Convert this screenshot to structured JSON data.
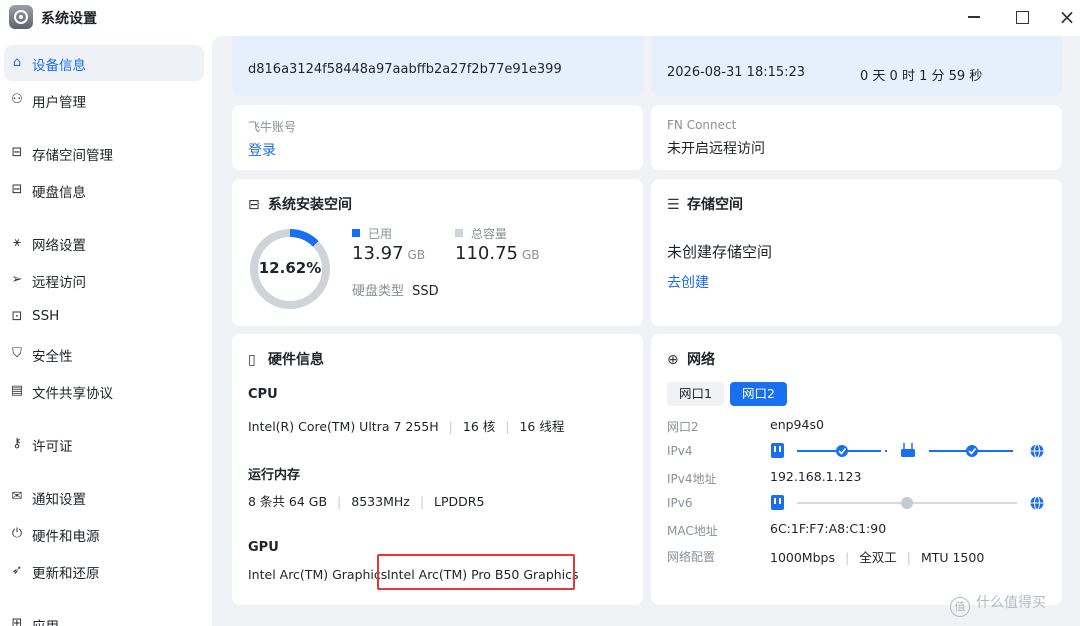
{
  "window": {
    "title": "系统设置"
  },
  "sidebar": {
    "items": [
      {
        "label": "设备信息",
        "icon": "device-icon",
        "active": true
      },
      {
        "label": "用户管理",
        "icon": "user-icon"
      },
      {
        "label": "存储空间管理",
        "icon": "storage-icon"
      },
      {
        "label": "硬盘信息",
        "icon": "disk-icon"
      },
      {
        "label": "网络设置",
        "icon": "network-icon"
      },
      {
        "label": "远程访问",
        "icon": "send-icon"
      },
      {
        "label": "SSH",
        "icon": "terminal-icon"
      },
      {
        "label": "安全性",
        "icon": "shield-icon"
      },
      {
        "label": "文件共享协议",
        "icon": "document-icon"
      },
      {
        "label": "许可证",
        "icon": "key-icon"
      },
      {
        "label": "通知设置",
        "icon": "mail-icon"
      },
      {
        "label": "硬件和电源",
        "icon": "power-icon"
      },
      {
        "label": "更新和还原",
        "icon": "rocket-icon"
      },
      {
        "label": "应用",
        "icon": "app-icon"
      }
    ]
  },
  "device": {
    "id": "d816a3124f58448a97aabffb2a27f2b77e91e399",
    "datetime": "2026-08-31 18:15:23",
    "uptime": "0 天 0 时 1 分 59 秒"
  },
  "account": {
    "label": "飞牛账号",
    "action": "登录"
  },
  "fn_connect": {
    "label": "FN Connect",
    "value": "未开启远程访问"
  },
  "system_space": {
    "title": "系统安装空间",
    "percent": 0.1262,
    "percent_text": "12.62%",
    "used_label": "已用",
    "used_value": "13.97",
    "used_unit": "GB",
    "total_label": "总容量",
    "total_value": "110.75",
    "total_unit": "GB",
    "disk_type_label": "硬盘类型",
    "disk_type_value": "SSD",
    "used_color": "#1a6ef0",
    "total_color": "#d0d4da"
  },
  "storage": {
    "title": "存储空间",
    "status": "未创建存储空间",
    "action": "去创建"
  },
  "hardware": {
    "title": "硬件信息",
    "cpu_label": "CPU",
    "cpu_model": "Intel(R) Core(TM) Ultra 7 255H",
    "cpu_cores": "16 核",
    "cpu_threads": "16 线程",
    "ram_label": "运行内存",
    "ram_size": "8 条共 64 GB",
    "ram_speed": "8533MHz",
    "ram_type": "LPDDR5",
    "gpu_label": "GPU",
    "gpu_1": "Intel Arc(TM) Graphics",
    "gpu_2": "Intel Arc(TM) Pro B50 Graphics",
    "highlight_color": "#e53935"
  },
  "network": {
    "title": "网络",
    "tabs": [
      {
        "label": "网口1",
        "active": false
      },
      {
        "label": "网口2",
        "active": true
      }
    ],
    "port_label": "网口2",
    "port_value": "enp94s0",
    "ipv4_label": "IPv4",
    "ipv4_addr_label": "IPv4地址",
    "ipv4_addr_value": "192.168.1.123",
    "ipv6_label": "IPv6",
    "mac_label": "MAC地址",
    "mac_value": "6C:1F:F7:A8:C1:90",
    "config_label": "网络配置",
    "config_speed": "1000Mbps",
    "config_duplex": "全双工",
    "config_mtu": "MTU 1500",
    "accent": "#1a6ef0"
  },
  "watermark": {
    "icon_text": "值",
    "text": "什么值得买"
  }
}
